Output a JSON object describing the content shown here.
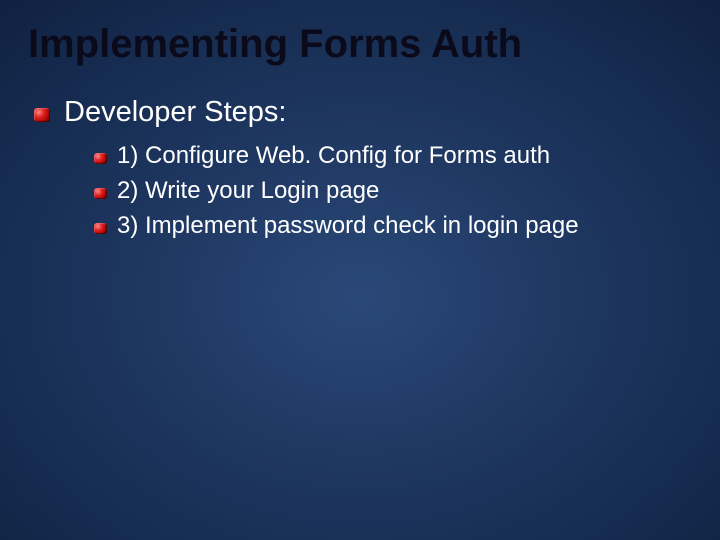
{
  "slide": {
    "title": "Implementing Forms Auth",
    "section_label": "Developer Steps:",
    "steps": [
      "1) Configure Web. Config for Forms auth",
      "2) Write your Login page",
      "3) Implement password check in login page"
    ]
  }
}
